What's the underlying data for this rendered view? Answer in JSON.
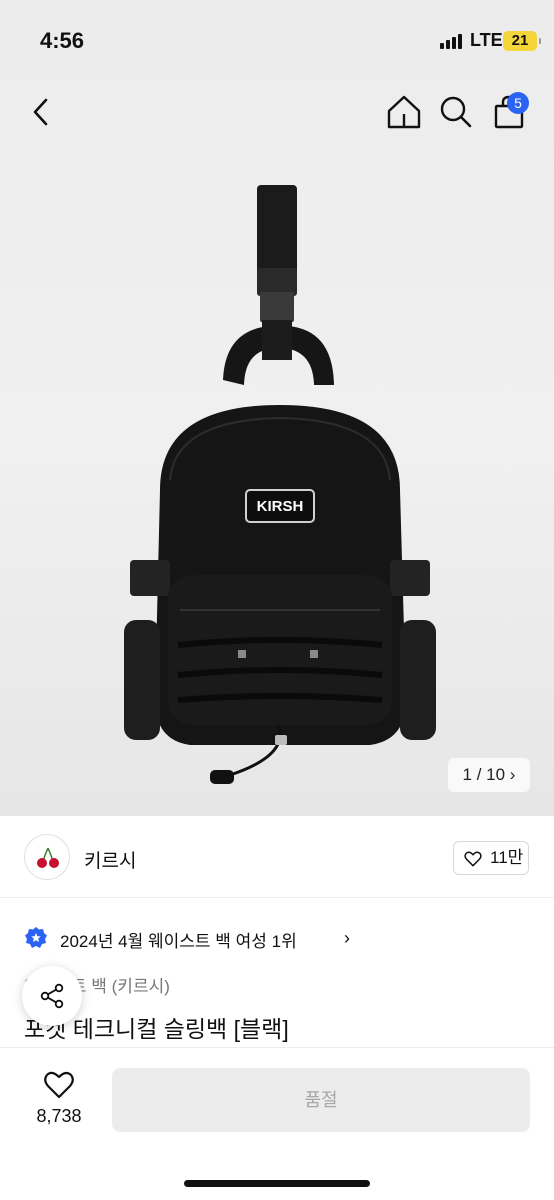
{
  "status_bar": {
    "time": "4:56",
    "network": "LTE",
    "battery": "21"
  },
  "header": {
    "back_icon": "chevron-left-icon",
    "home_icon": "home-icon",
    "search_icon": "search-icon",
    "cart_icon": "shopping-bag-icon",
    "cart_badge": "5"
  },
  "hero": {
    "product_logo_text": "KIRSH",
    "pager": "1 / 10",
    "pager_chevron": "›"
  },
  "brand": {
    "name": "키르시",
    "like_count": "11만",
    "logo_icon": "cherry-icon"
  },
  "ranking": {
    "text": "2024년 4월 웨이스트 백 여성 1위",
    "chevron": "›",
    "badge_icon": "star-badge-icon"
  },
  "product": {
    "category": "웨이스트 백 (키르시)",
    "title": "포켓 테크니컬 슬링백 [블랙]"
  },
  "bottom_bar": {
    "wish_count": "8,738",
    "buy_label": "품절",
    "share_icon": "share-icon"
  },
  "colors": {
    "accent": "#2b64f4",
    "battery": "#f4d63a",
    "disabled_button": "#ececec"
  }
}
